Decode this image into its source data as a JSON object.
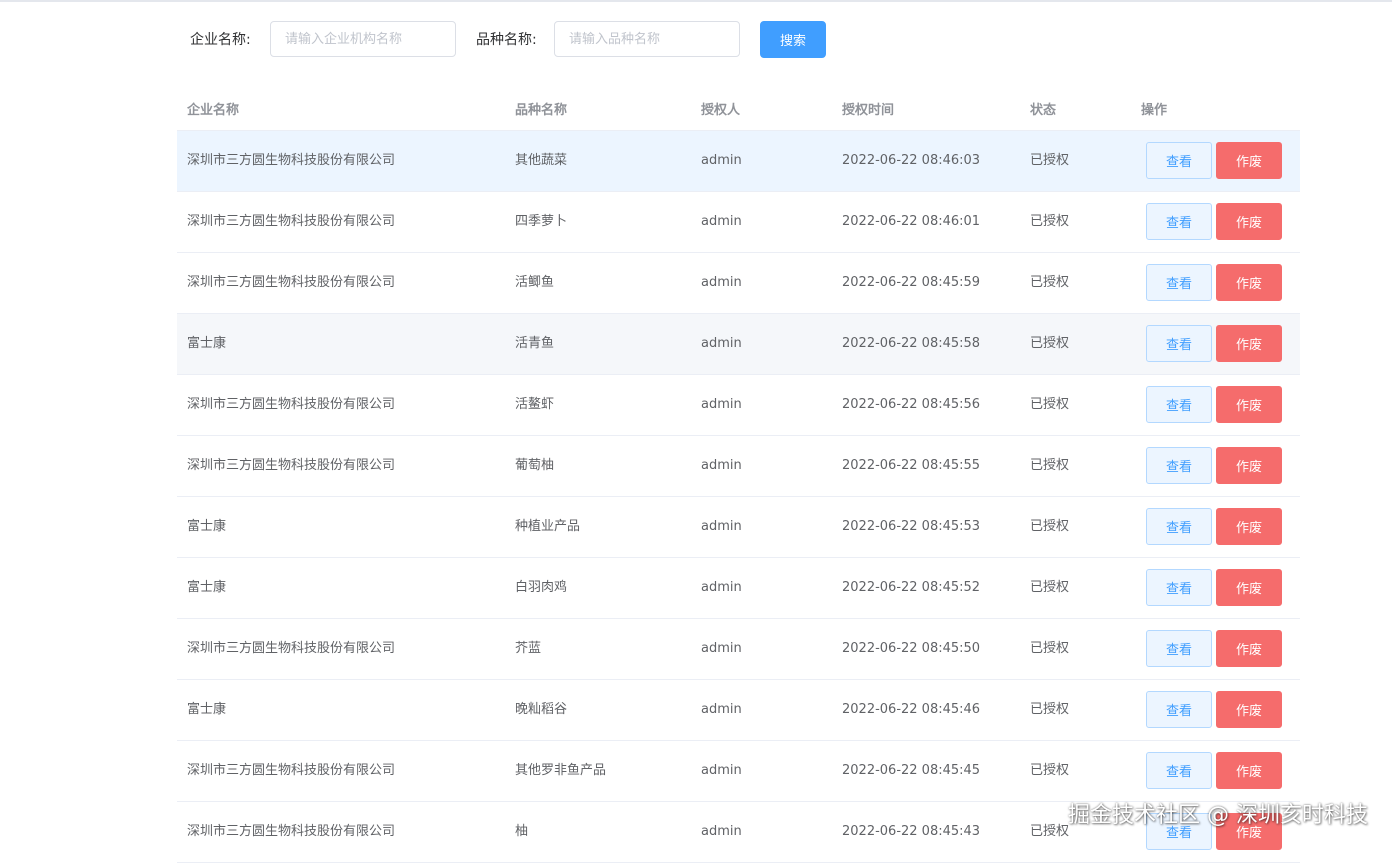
{
  "search": {
    "company_label": "企业名称:",
    "company_placeholder": "请输入企业机构名称",
    "variety_label": "品种名称:",
    "variety_placeholder": "请输入品种名称",
    "search_button": "搜索"
  },
  "table": {
    "headers": [
      "企业名称",
      "品种名称",
      "授权人",
      "授权时间",
      "状态",
      "操作"
    ],
    "view_label": "查看",
    "void_label": "作废",
    "rows": [
      {
        "company": "深圳市三方圆生物科技股份有限公司",
        "variety": "其他蔬菜",
        "authorizer": "admin",
        "time": "2022-06-22 08:46:03",
        "status": "已授权"
      },
      {
        "company": "深圳市三方圆生物科技股份有限公司",
        "variety": "四季萝卜",
        "authorizer": "admin",
        "time": "2022-06-22 08:46:01",
        "status": "已授权"
      },
      {
        "company": "深圳市三方圆生物科技股份有限公司",
        "variety": "活鲫鱼",
        "authorizer": "admin",
        "time": "2022-06-22 08:45:59",
        "status": "已授权"
      },
      {
        "company": "富士康",
        "variety": "活青鱼",
        "authorizer": "admin",
        "time": "2022-06-22 08:45:58",
        "status": "已授权"
      },
      {
        "company": "深圳市三方圆生物科技股份有限公司",
        "variety": "活鳌虾",
        "authorizer": "admin",
        "time": "2022-06-22 08:45:56",
        "status": "已授权"
      },
      {
        "company": "深圳市三方圆生物科技股份有限公司",
        "variety": "葡萄柚",
        "authorizer": "admin",
        "time": "2022-06-22 08:45:55",
        "status": "已授权"
      },
      {
        "company": "富士康",
        "variety": "种植业产品",
        "authorizer": "admin",
        "time": "2022-06-22 08:45:53",
        "status": "已授权"
      },
      {
        "company": "富士康",
        "variety": "白羽肉鸡",
        "authorizer": "admin",
        "time": "2022-06-22 08:45:52",
        "status": "已授权"
      },
      {
        "company": "深圳市三方圆生物科技股份有限公司",
        "variety": "芥蓝",
        "authorizer": "admin",
        "time": "2022-06-22 08:45:50",
        "status": "已授权"
      },
      {
        "company": "富士康",
        "variety": "晚籼稻谷",
        "authorizer": "admin",
        "time": "2022-06-22 08:45:46",
        "status": "已授权"
      },
      {
        "company": "深圳市三方圆生物科技股份有限公司",
        "variety": "其他罗非鱼产品",
        "authorizer": "admin",
        "time": "2022-06-22 08:45:45",
        "status": "已授权"
      },
      {
        "company": "深圳市三方圆生物科技股份有限公司",
        "variety": "柚",
        "authorizer": "admin",
        "time": "2022-06-22 08:45:43",
        "status": "已授权"
      }
    ]
  },
  "watermark": "掘金技术社区 @ 深圳亥时科技",
  "colors": {
    "primary": "#409eff",
    "danger": "#f56c6c",
    "hover_row": "#ecf5ff",
    "stripe_row": "#f5f7fa"
  }
}
